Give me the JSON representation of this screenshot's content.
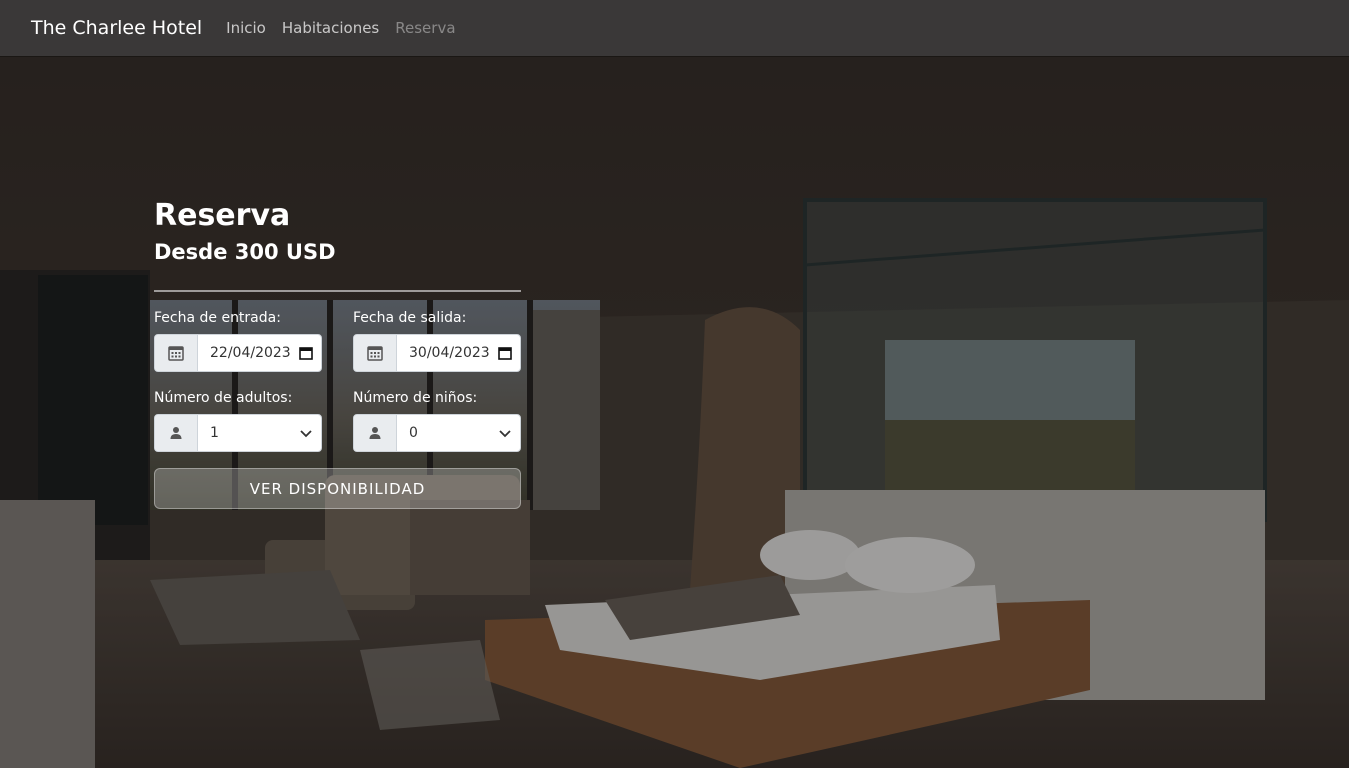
{
  "nav": {
    "brand": "The Charlee Hotel",
    "links": [
      "Inicio",
      "Habitaciones",
      "Reserva"
    ]
  },
  "form": {
    "title": "Reserva",
    "subtitle": "Desde 300 USD",
    "checkin_label": "Fecha de entrada:",
    "checkin_value": "22/04/2023",
    "checkout_label": "Fecha de salida:",
    "checkout_value": "30/04/2023",
    "adults_label": "Número de adultos:",
    "adults_value": "1",
    "children_label": "Número de niños:",
    "children_value": "0",
    "button": "VER DISPONIBILIDAD"
  },
  "icons": {
    "date": "calendar-icon",
    "person": "person-icon",
    "select": "chevron-down-icon"
  },
  "colors": {
    "navbar_bg": "#3a3838",
    "text": "#ffffff"
  }
}
